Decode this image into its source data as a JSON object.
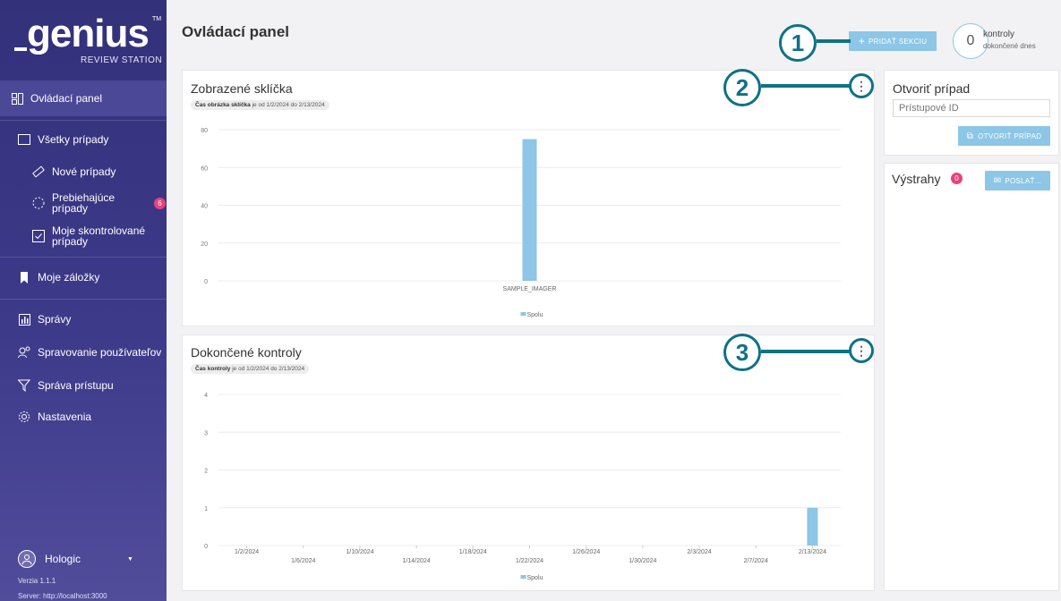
{
  "sidebar": {
    "logo": {
      "word": "genius",
      "tm": "TM",
      "subtitle": "REVIEW STATION"
    },
    "items": [
      {
        "label": "Ovládací panel"
      },
      {
        "label": "Všetky prípady"
      },
      {
        "label": "Nové prípady"
      },
      {
        "label": "Prebiehajúce prípady"
      },
      {
        "label": "Moje skontrolované prípady"
      },
      {
        "label": "Moje záložky"
      },
      {
        "label": "Správy"
      },
      {
        "label": "Spravovanie používateľov"
      },
      {
        "label": "Správa prístupu"
      },
      {
        "label": "Nastavenia"
      }
    ],
    "in_progress_badge": "6",
    "user": {
      "name": "Hologic"
    },
    "version": "Verzia 1.1.1",
    "server": "Server: http://localhost:3000"
  },
  "header": {
    "title": "Ovládací panel",
    "add_section_label": "PRIDAŤ SEKCIU",
    "checks_count": "0",
    "checks_label": "kontroly",
    "checks_sub": "dokončené dnes"
  },
  "callouts": [
    "1",
    "2",
    "3"
  ],
  "open_case": {
    "title": "Otvoriť prípad",
    "input_placeholder": "Prístupové ID",
    "button_label": "OTVORIŤ PRÍPAD"
  },
  "alerts": {
    "title": "Výstrahy",
    "count": "0",
    "send_label": "POSLAŤ..."
  },
  "chart_data": [
    {
      "type": "bar",
      "title": "Zobrazené sklíčka",
      "filter_bold": "Čas obrázka sklíčka",
      "filter_rest": "je od 1/2/2024 do 2/13/2024",
      "categories": [
        "SAMPLE_IMAGER"
      ],
      "series": [
        {
          "name": "Spolu",
          "values": [
            75
          ]
        }
      ],
      "ylim": [
        0,
        80
      ],
      "yticks": [
        0,
        20,
        40,
        60,
        80
      ],
      "grid": true,
      "legend": "bottom",
      "color": "#8dc6e6"
    },
    {
      "type": "bar",
      "title": "Dokončené kontroly",
      "filter_bold": "Čas kontroly",
      "filter_rest": "je od 1/2/2024 do 2/13/2024",
      "categories": [
        "1/2/2024",
        "1/6/2024",
        "1/10/2024",
        "1/14/2024",
        "1/18/2024",
        "1/22/2024",
        "1/26/2024",
        "1/30/2024",
        "2/3/2024",
        "2/7/2024",
        "2/13/2024"
      ],
      "series": [
        {
          "name": "Spolu",
          "values": [
            0,
            0,
            0,
            0,
            0,
            0,
            0,
            0,
            0,
            0,
            1
          ]
        }
      ],
      "ylim": [
        0,
        4
      ],
      "yticks": [
        0,
        1,
        2,
        3,
        4
      ],
      "grid": true,
      "legend": "bottom",
      "color": "#8dc6e6"
    }
  ]
}
